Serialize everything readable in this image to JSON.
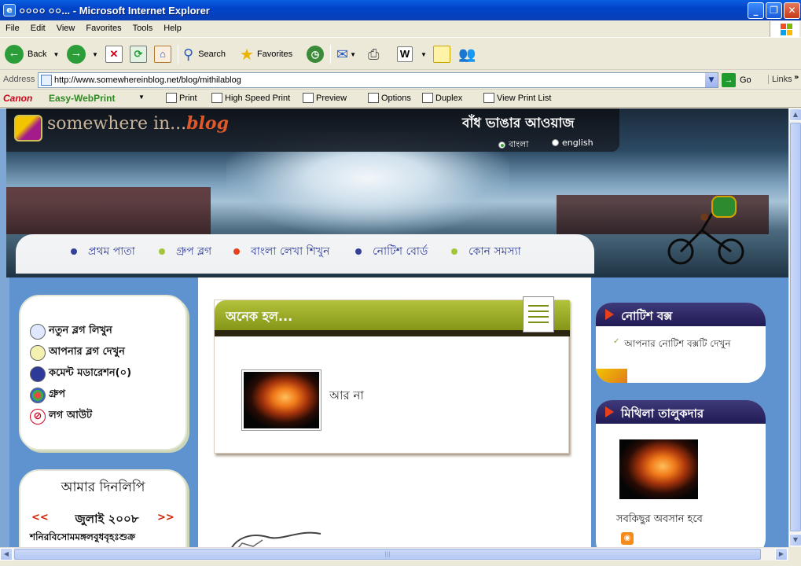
{
  "window": {
    "title": "০০০০ ০০... - Microsoft Internet Explorer",
    "minimize": "_",
    "maximize": "❐",
    "close": "✕"
  },
  "menu": [
    "File",
    "Edit",
    "View",
    "Favorites",
    "Tools",
    "Help"
  ],
  "toolbar": {
    "back": "Back",
    "search": "Search",
    "favorites": "Favorites"
  },
  "address": {
    "label": "Address",
    "url": "http://www.somewhereinblog.net/blog/mithilablog",
    "go": "Go",
    "links": "Links"
  },
  "canon": {
    "brand": "Canon",
    "product": "Easy-WebPrint",
    "items": [
      "Print",
      "High Speed Print",
      "Preview",
      "Options",
      "Duplex",
      "View Print List"
    ]
  },
  "banner": {
    "logo_text": "somewhere in...",
    "logo_blog": "blog",
    "slogan": "বাঁধ ভাঙার আওয়াজ",
    "lang_bangla": "বাংলা",
    "lang_english": "english",
    "nav": [
      {
        "label": "প্রথম পাতা",
        "dot": "#35409a"
      },
      {
        "label": "গ্রুপ ব্লগ",
        "dot": "#a4c43a"
      },
      {
        "label": "বাংলা লেখা শিখুন",
        "dot": "#e8401a"
      },
      {
        "label": "নোটিশ বোর্ড",
        "dot": "#35409a"
      },
      {
        "label": "কোন সমস্যা",
        "dot": "#a4c43a"
      }
    ]
  },
  "sidebar": {
    "items": [
      {
        "label": "নতুন ব্লগ লিখুন",
        "icon": "pencil-icon"
      },
      {
        "label": "আপনার ব্লগ দেখুন",
        "icon": "notebook-icon"
      },
      {
        "label": "কমেন্ট মডারেশন(০)",
        "icon": "moderation-icon"
      },
      {
        "label": "গ্রুপ",
        "icon": "group-icon"
      },
      {
        "label": "লগ আউট",
        "icon": "logout-icon"
      }
    ],
    "diary_title": "আমার দিনলিপি",
    "prev": "<<",
    "next": ">>",
    "month": "জুলাই ২০০৮",
    "days": "শনিরবিসোমমঙ্গলবুধবৃহঃশুক্র"
  },
  "post": {
    "title": "অনেক হল...",
    "text": "আর না"
  },
  "notice": {
    "title": "নোটিশ বক্স",
    "link": "আপনার নোটিশ বক্সটি দেখুন"
  },
  "profile": {
    "name": "মিথিলা তালুকদার",
    "tagline": "সবকিছুর অবসান হবে"
  }
}
